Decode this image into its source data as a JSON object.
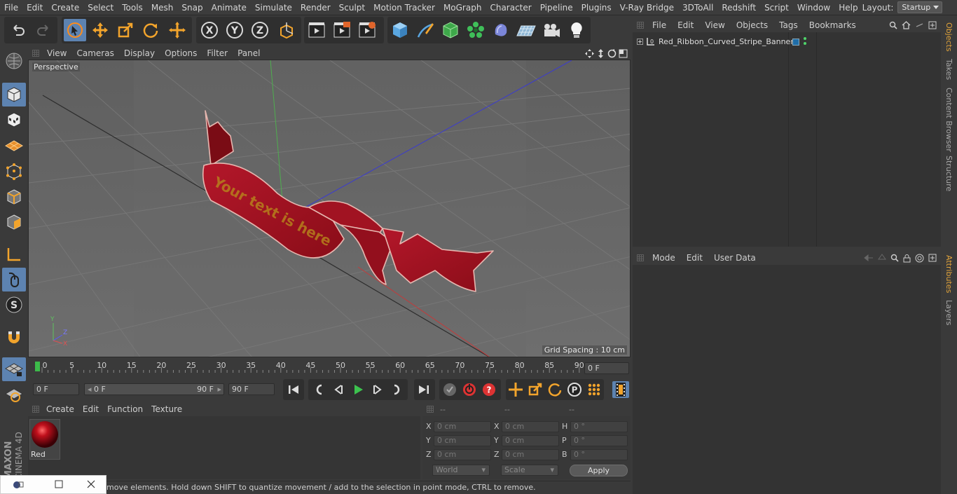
{
  "menubar": {
    "items": [
      "File",
      "Edit",
      "Create",
      "Select",
      "Tools",
      "Mesh",
      "Snap",
      "Animate",
      "Simulate",
      "Render",
      "Sculpt",
      "Motion Tracker",
      "MoGraph",
      "Character",
      "Pipeline",
      "Plugins",
      "V-Ray Bridge",
      "3DToAll",
      "Redshift",
      "Script",
      "Window",
      "Help"
    ],
    "layout_label": "Layout:",
    "layout_value": "Startup"
  },
  "viewport": {
    "menu": [
      "View",
      "Cameras",
      "Display",
      "Options",
      "Filter",
      "Panel"
    ],
    "camera_label": "Perspective",
    "grid_spacing": "Grid Spacing : 10 cm",
    "ribbon_text": "Your text is here"
  },
  "timeline": {
    "ticks": [
      "0",
      "5",
      "10",
      "15",
      "20",
      "25",
      "30",
      "35",
      "40",
      "45",
      "50",
      "55",
      "60",
      "65",
      "70",
      "75",
      "80",
      "85",
      "90"
    ],
    "current_frame": "0 F"
  },
  "transport": {
    "start_field": "0 F",
    "range_start": "0 F",
    "range_end": "90 F",
    "end_field": "90 F"
  },
  "materials": {
    "menu": [
      "Create",
      "Edit",
      "Function",
      "Texture"
    ],
    "items": [
      {
        "name": "Red",
        "color": "#b00010"
      }
    ]
  },
  "coordinates": {
    "headers": [
      "--",
      "--",
      "--"
    ],
    "pos": [
      {
        "axis": "X",
        "value": "0 cm"
      },
      {
        "axis": "Y",
        "value": "0 cm"
      },
      {
        "axis": "Z",
        "value": "0 cm"
      }
    ],
    "size": [
      {
        "axis": "X",
        "value": "0 cm"
      },
      {
        "axis": "Y",
        "value": "0 cm"
      },
      {
        "axis": "Z",
        "value": "0 cm"
      }
    ],
    "rot": [
      {
        "axis": "H",
        "value": "0 °"
      },
      {
        "axis": "P",
        "value": "0 °"
      },
      {
        "axis": "B",
        "value": "0 °"
      }
    ],
    "space": "World",
    "mode": "Scale",
    "apply_label": "Apply"
  },
  "objects": {
    "menu": [
      "File",
      "Edit",
      "View",
      "Objects",
      "Tags",
      "Bookmarks"
    ],
    "items": [
      {
        "name": "Red_Ribbon_Curved_Stripe_Banner"
      }
    ]
  },
  "attributes": {
    "menu": [
      "Mode",
      "Edit",
      "User Data"
    ]
  },
  "sidetabs": [
    "Objects",
    "Takes",
    "Content Browser",
    "Structure",
    "Attributes",
    "Layers"
  ],
  "status": {
    "text": "move elements. Hold down SHIFT to quantize movement / add to the selection in point mode, CTRL to remove."
  },
  "branding": {
    "line1": "MAXON",
    "line2": "CINEMA 4D"
  },
  "colors": {
    "accent": "#5d83b1",
    "ribbon": "#a3121e",
    "active_tab": "#e0a33a"
  }
}
